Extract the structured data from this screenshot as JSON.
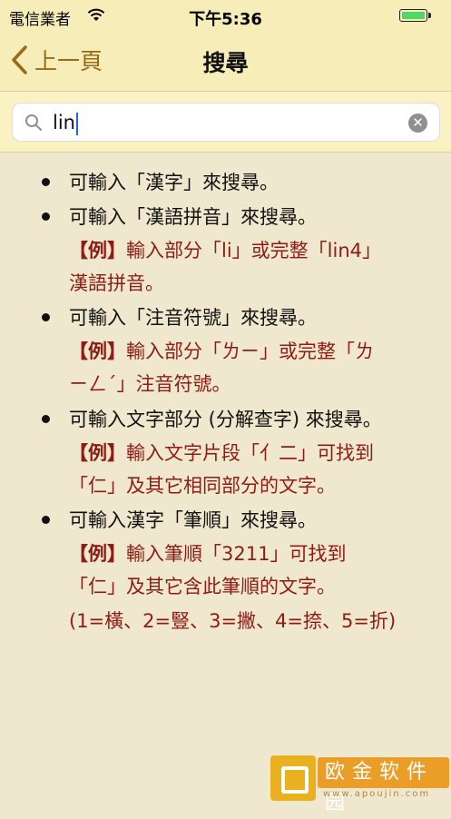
{
  "status_bar": {
    "carrier": "電信業者",
    "time": "下午5:36"
  },
  "nav": {
    "back_label": "上一頁",
    "title": "搜尋"
  },
  "search": {
    "value": "lin",
    "clear_glyph": "✕"
  },
  "help": {
    "items": [
      {
        "text": "可輸入「漢字」來搜尋。"
      },
      {
        "text": "可輸入「漢語拼音」來搜尋。",
        "example_tag": "【例】",
        "example_line1": "輸入部分「li」或完整「lin4」",
        "example_line2": "漢語拼音。"
      },
      {
        "text": "可輸入「注音符號」來搜尋。",
        "example_tag": "【例】",
        "example_line1": "輸入部分「ㄌㄧ」或完整「ㄌ",
        "example_line2": "ㄧㄥˊ」注音符號。"
      },
      {
        "text": "可輸入文字部分 (分解查字) 來搜尋。",
        "example_tag": "【例】",
        "example_line1": "輸入文字片段「亻二」可找到",
        "example_line2": "「仁」及其它相同部分的文字。"
      },
      {
        "text": "可輸入漢字「筆順」來搜尋。",
        "example_tag": "【例】",
        "example_line1": "輸入筆順「3211」可找到",
        "example_line2": "「仁」及其它含此筆順的文字。",
        "example_line3": "(1=橫、2=豎、3=撇、4=捺、5=折)"
      }
    ]
  },
  "watermark": {
    "text": "欧金软件园",
    "url": "www.apoujin.com"
  },
  "colors": {
    "nav_background": "#f7edb9",
    "accent": "#9a6a16",
    "example_red": "#8c1c14",
    "battery_green": "#4cd964"
  }
}
